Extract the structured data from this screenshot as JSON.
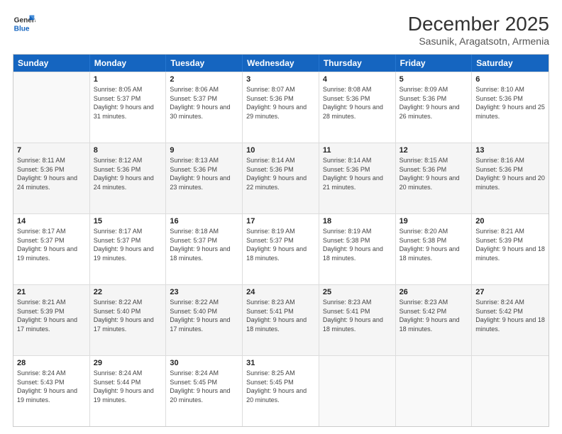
{
  "header": {
    "logo_general": "General",
    "logo_blue": "Blue",
    "main_title": "December 2025",
    "subtitle": "Sasunik, Aragatsotn, Armenia"
  },
  "calendar": {
    "weekdays": [
      "Sunday",
      "Monday",
      "Tuesday",
      "Wednesday",
      "Thursday",
      "Friday",
      "Saturday"
    ],
    "rows": [
      [
        {
          "day": "",
          "sunrise": "",
          "sunset": "",
          "daylight": "",
          "empty": true
        },
        {
          "day": "1",
          "sunrise": "Sunrise: 8:05 AM",
          "sunset": "Sunset: 5:37 PM",
          "daylight": "Daylight: 9 hours and 31 minutes."
        },
        {
          "day": "2",
          "sunrise": "Sunrise: 8:06 AM",
          "sunset": "Sunset: 5:37 PM",
          "daylight": "Daylight: 9 hours and 30 minutes."
        },
        {
          "day": "3",
          "sunrise": "Sunrise: 8:07 AM",
          "sunset": "Sunset: 5:36 PM",
          "daylight": "Daylight: 9 hours and 29 minutes."
        },
        {
          "day": "4",
          "sunrise": "Sunrise: 8:08 AM",
          "sunset": "Sunset: 5:36 PM",
          "daylight": "Daylight: 9 hours and 28 minutes."
        },
        {
          "day": "5",
          "sunrise": "Sunrise: 8:09 AM",
          "sunset": "Sunset: 5:36 PM",
          "daylight": "Daylight: 9 hours and 26 minutes."
        },
        {
          "day": "6",
          "sunrise": "Sunrise: 8:10 AM",
          "sunset": "Sunset: 5:36 PM",
          "daylight": "Daylight: 9 hours and 25 minutes."
        }
      ],
      [
        {
          "day": "7",
          "sunrise": "Sunrise: 8:11 AM",
          "sunset": "Sunset: 5:36 PM",
          "daylight": "Daylight: 9 hours and 24 minutes."
        },
        {
          "day": "8",
          "sunrise": "Sunrise: 8:12 AM",
          "sunset": "Sunset: 5:36 PM",
          "daylight": "Daylight: 9 hours and 24 minutes."
        },
        {
          "day": "9",
          "sunrise": "Sunrise: 8:13 AM",
          "sunset": "Sunset: 5:36 PM",
          "daylight": "Daylight: 9 hours and 23 minutes."
        },
        {
          "day": "10",
          "sunrise": "Sunrise: 8:14 AM",
          "sunset": "Sunset: 5:36 PM",
          "daylight": "Daylight: 9 hours and 22 minutes."
        },
        {
          "day": "11",
          "sunrise": "Sunrise: 8:14 AM",
          "sunset": "Sunset: 5:36 PM",
          "daylight": "Daylight: 9 hours and 21 minutes."
        },
        {
          "day": "12",
          "sunrise": "Sunrise: 8:15 AM",
          "sunset": "Sunset: 5:36 PM",
          "daylight": "Daylight: 9 hours and 20 minutes."
        },
        {
          "day": "13",
          "sunrise": "Sunrise: 8:16 AM",
          "sunset": "Sunset: 5:36 PM",
          "daylight": "Daylight: 9 hours and 20 minutes."
        }
      ],
      [
        {
          "day": "14",
          "sunrise": "Sunrise: 8:17 AM",
          "sunset": "Sunset: 5:37 PM",
          "daylight": "Daylight: 9 hours and 19 minutes."
        },
        {
          "day": "15",
          "sunrise": "Sunrise: 8:17 AM",
          "sunset": "Sunset: 5:37 PM",
          "daylight": "Daylight: 9 hours and 19 minutes."
        },
        {
          "day": "16",
          "sunrise": "Sunrise: 8:18 AM",
          "sunset": "Sunset: 5:37 PM",
          "daylight": "Daylight: 9 hours and 18 minutes."
        },
        {
          "day": "17",
          "sunrise": "Sunrise: 8:19 AM",
          "sunset": "Sunset: 5:37 PM",
          "daylight": "Daylight: 9 hours and 18 minutes."
        },
        {
          "day": "18",
          "sunrise": "Sunrise: 8:19 AM",
          "sunset": "Sunset: 5:38 PM",
          "daylight": "Daylight: 9 hours and 18 minutes."
        },
        {
          "day": "19",
          "sunrise": "Sunrise: 8:20 AM",
          "sunset": "Sunset: 5:38 PM",
          "daylight": "Daylight: 9 hours and 18 minutes."
        },
        {
          "day": "20",
          "sunrise": "Sunrise: 8:21 AM",
          "sunset": "Sunset: 5:39 PM",
          "daylight": "Daylight: 9 hours and 18 minutes."
        }
      ],
      [
        {
          "day": "21",
          "sunrise": "Sunrise: 8:21 AM",
          "sunset": "Sunset: 5:39 PM",
          "daylight": "Daylight: 9 hours and 17 minutes."
        },
        {
          "day": "22",
          "sunrise": "Sunrise: 8:22 AM",
          "sunset": "Sunset: 5:40 PM",
          "daylight": "Daylight: 9 hours and 17 minutes."
        },
        {
          "day": "23",
          "sunrise": "Sunrise: 8:22 AM",
          "sunset": "Sunset: 5:40 PM",
          "daylight": "Daylight: 9 hours and 17 minutes."
        },
        {
          "day": "24",
          "sunrise": "Sunrise: 8:23 AM",
          "sunset": "Sunset: 5:41 PM",
          "daylight": "Daylight: 9 hours and 18 minutes."
        },
        {
          "day": "25",
          "sunrise": "Sunrise: 8:23 AM",
          "sunset": "Sunset: 5:41 PM",
          "daylight": "Daylight: 9 hours and 18 minutes."
        },
        {
          "day": "26",
          "sunrise": "Sunrise: 8:23 AM",
          "sunset": "Sunset: 5:42 PM",
          "daylight": "Daylight: 9 hours and 18 minutes."
        },
        {
          "day": "27",
          "sunrise": "Sunrise: 8:24 AM",
          "sunset": "Sunset: 5:42 PM",
          "daylight": "Daylight: 9 hours and 18 minutes."
        }
      ],
      [
        {
          "day": "28",
          "sunrise": "Sunrise: 8:24 AM",
          "sunset": "Sunset: 5:43 PM",
          "daylight": "Daylight: 9 hours and 19 minutes."
        },
        {
          "day": "29",
          "sunrise": "Sunrise: 8:24 AM",
          "sunset": "Sunset: 5:44 PM",
          "daylight": "Daylight: 9 hours and 19 minutes."
        },
        {
          "day": "30",
          "sunrise": "Sunrise: 8:24 AM",
          "sunset": "Sunset: 5:45 PM",
          "daylight": "Daylight: 9 hours and 20 minutes."
        },
        {
          "day": "31",
          "sunrise": "Sunrise: 8:25 AM",
          "sunset": "Sunset: 5:45 PM",
          "daylight": "Daylight: 9 hours and 20 minutes."
        },
        {
          "day": "",
          "sunrise": "",
          "sunset": "",
          "daylight": "",
          "empty": true
        },
        {
          "day": "",
          "sunrise": "",
          "sunset": "",
          "daylight": "",
          "empty": true
        },
        {
          "day": "",
          "sunrise": "",
          "sunset": "",
          "daylight": "",
          "empty": true
        }
      ]
    ]
  }
}
